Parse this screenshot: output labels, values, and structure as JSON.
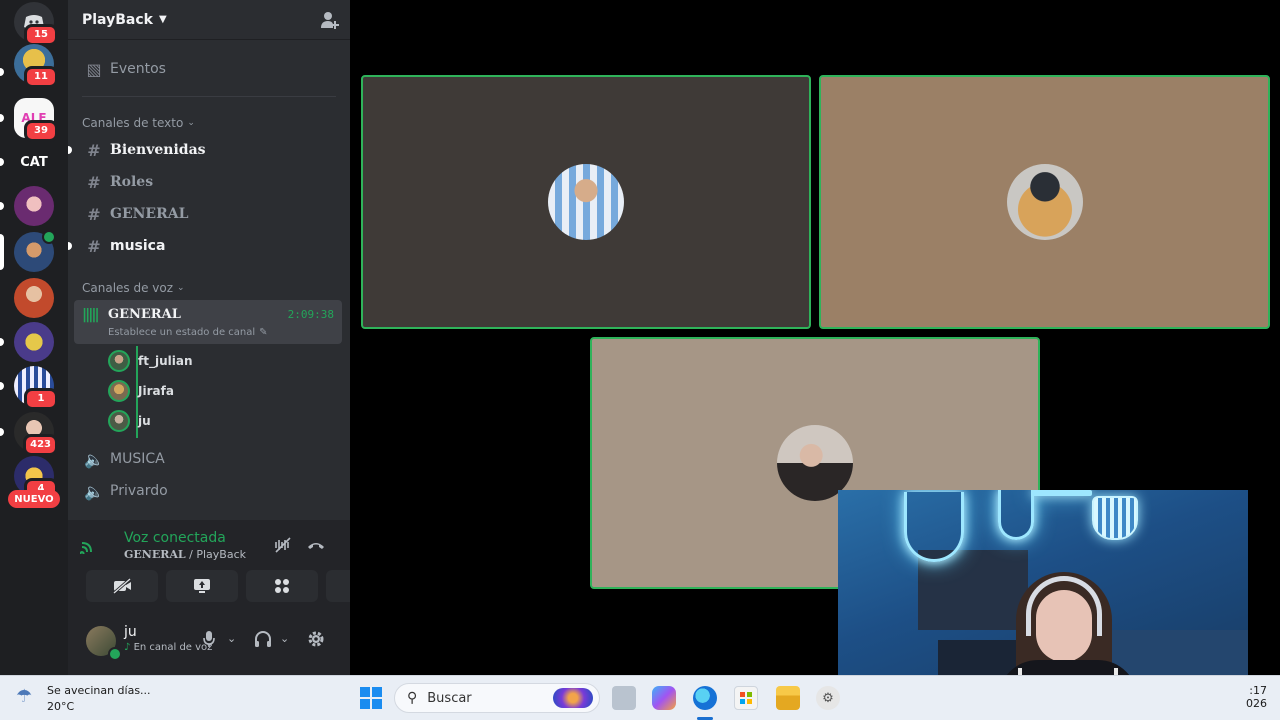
{
  "server": {
    "name": "PlayBack",
    "events_label": "Eventos",
    "text_category": "Canales de texto",
    "text_channels": [
      {
        "name": "Bienvenidas",
        "unread": true
      },
      {
        "name": "Roles",
        "unread": false
      },
      {
        "name": "GENERAL",
        "unread": false
      },
      {
        "name": "musica",
        "unread": true
      }
    ],
    "voice_category": "Canales de voz",
    "active_voice": {
      "name": "GENERAL",
      "timer": "2:09:38",
      "status_placeholder": "Establece un estado de canal"
    },
    "voice_users": [
      "ft_julian",
      "Jirafa",
      "ju"
    ],
    "voice_channels": [
      "MUSICA",
      "Privardo"
    ]
  },
  "rail": {
    "badges": [
      "15",
      "11",
      "39",
      "1",
      "423",
      "4"
    ],
    "cat_label": "CAT",
    "nuevo_label": "NUEVO"
  },
  "voice_panel": {
    "title": "Voz conectada",
    "channel": "GENERAL",
    "server": "PlayBack",
    "separator": " / "
  },
  "user": {
    "name": "ju",
    "status": "En canal de voz"
  },
  "taskbar": {
    "weather_title": "Se avecinan días...",
    "weather_temp": "20°C",
    "search_label": "Buscar",
    "clock_time": ":17",
    "clock_date": "026"
  },
  "colors": {
    "speaking_border": "#2fb35a",
    "online": "#23a55a",
    "badge": "#f23f43"
  }
}
